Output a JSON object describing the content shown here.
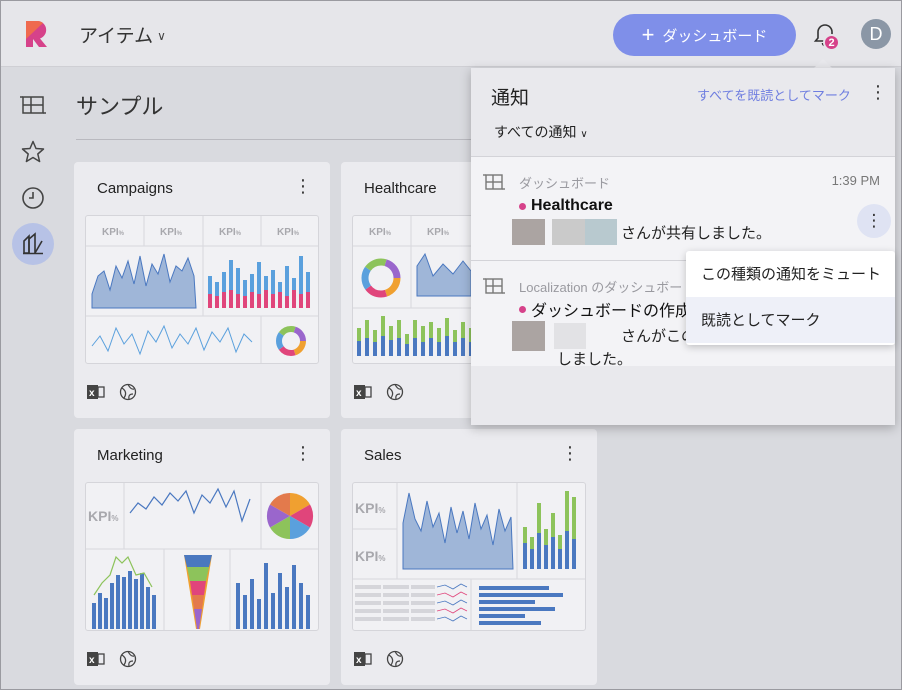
{
  "header": {
    "app_title": "アイテム",
    "new_dashboard_label": "ダッシュボード",
    "notification_count": "2",
    "avatar_initial": "D"
  },
  "colors": {
    "accent": "#7f8fe9",
    "badge": "#d6428a",
    "chart_blue": "#4a78c0",
    "chart_pink": "#e0457b",
    "chart_green": "#8dc35b"
  },
  "sidebar": {
    "items": [
      {
        "icon": "dashboard-grid-icon"
      },
      {
        "icon": "star-icon"
      },
      {
        "icon": "clock-icon"
      },
      {
        "icon": "library-icon",
        "active": true
      }
    ]
  },
  "main": {
    "page_title": "サンプル",
    "cards": [
      {
        "title": "Campaigns",
        "kpi_label": "KPI",
        "kpi_unit": "%"
      },
      {
        "title": "Healthcare",
        "kpi_label": "KPI",
        "kpi_unit": "%"
      },
      {
        "title": "Marketing",
        "kpi_label": "KPI",
        "kpi_unit": "%"
      },
      {
        "title": "Sales",
        "kpi_label": "KPI",
        "kpi_unit": "%"
      }
    ],
    "card_menu_glyph": "⋮"
  },
  "notifications": {
    "title": "通知",
    "mark_all_read": "すべてを既読としてマーク",
    "filter_label": "すべての通知",
    "items": [
      {
        "source": "ダッシュボード",
        "time": "1:39 PM",
        "headline": "Healthcare",
        "message": "さんが共有しました。"
      },
      {
        "source": "Localization のダッシュボード",
        "headline": "ダッシュボードの作成",
        "message_line1": "さんがこの",
        "message_line2": "しました。"
      }
    ],
    "context_menu": [
      {
        "label": "この種類の通知をミュート"
      },
      {
        "label": "既読としてマーク"
      }
    ]
  }
}
